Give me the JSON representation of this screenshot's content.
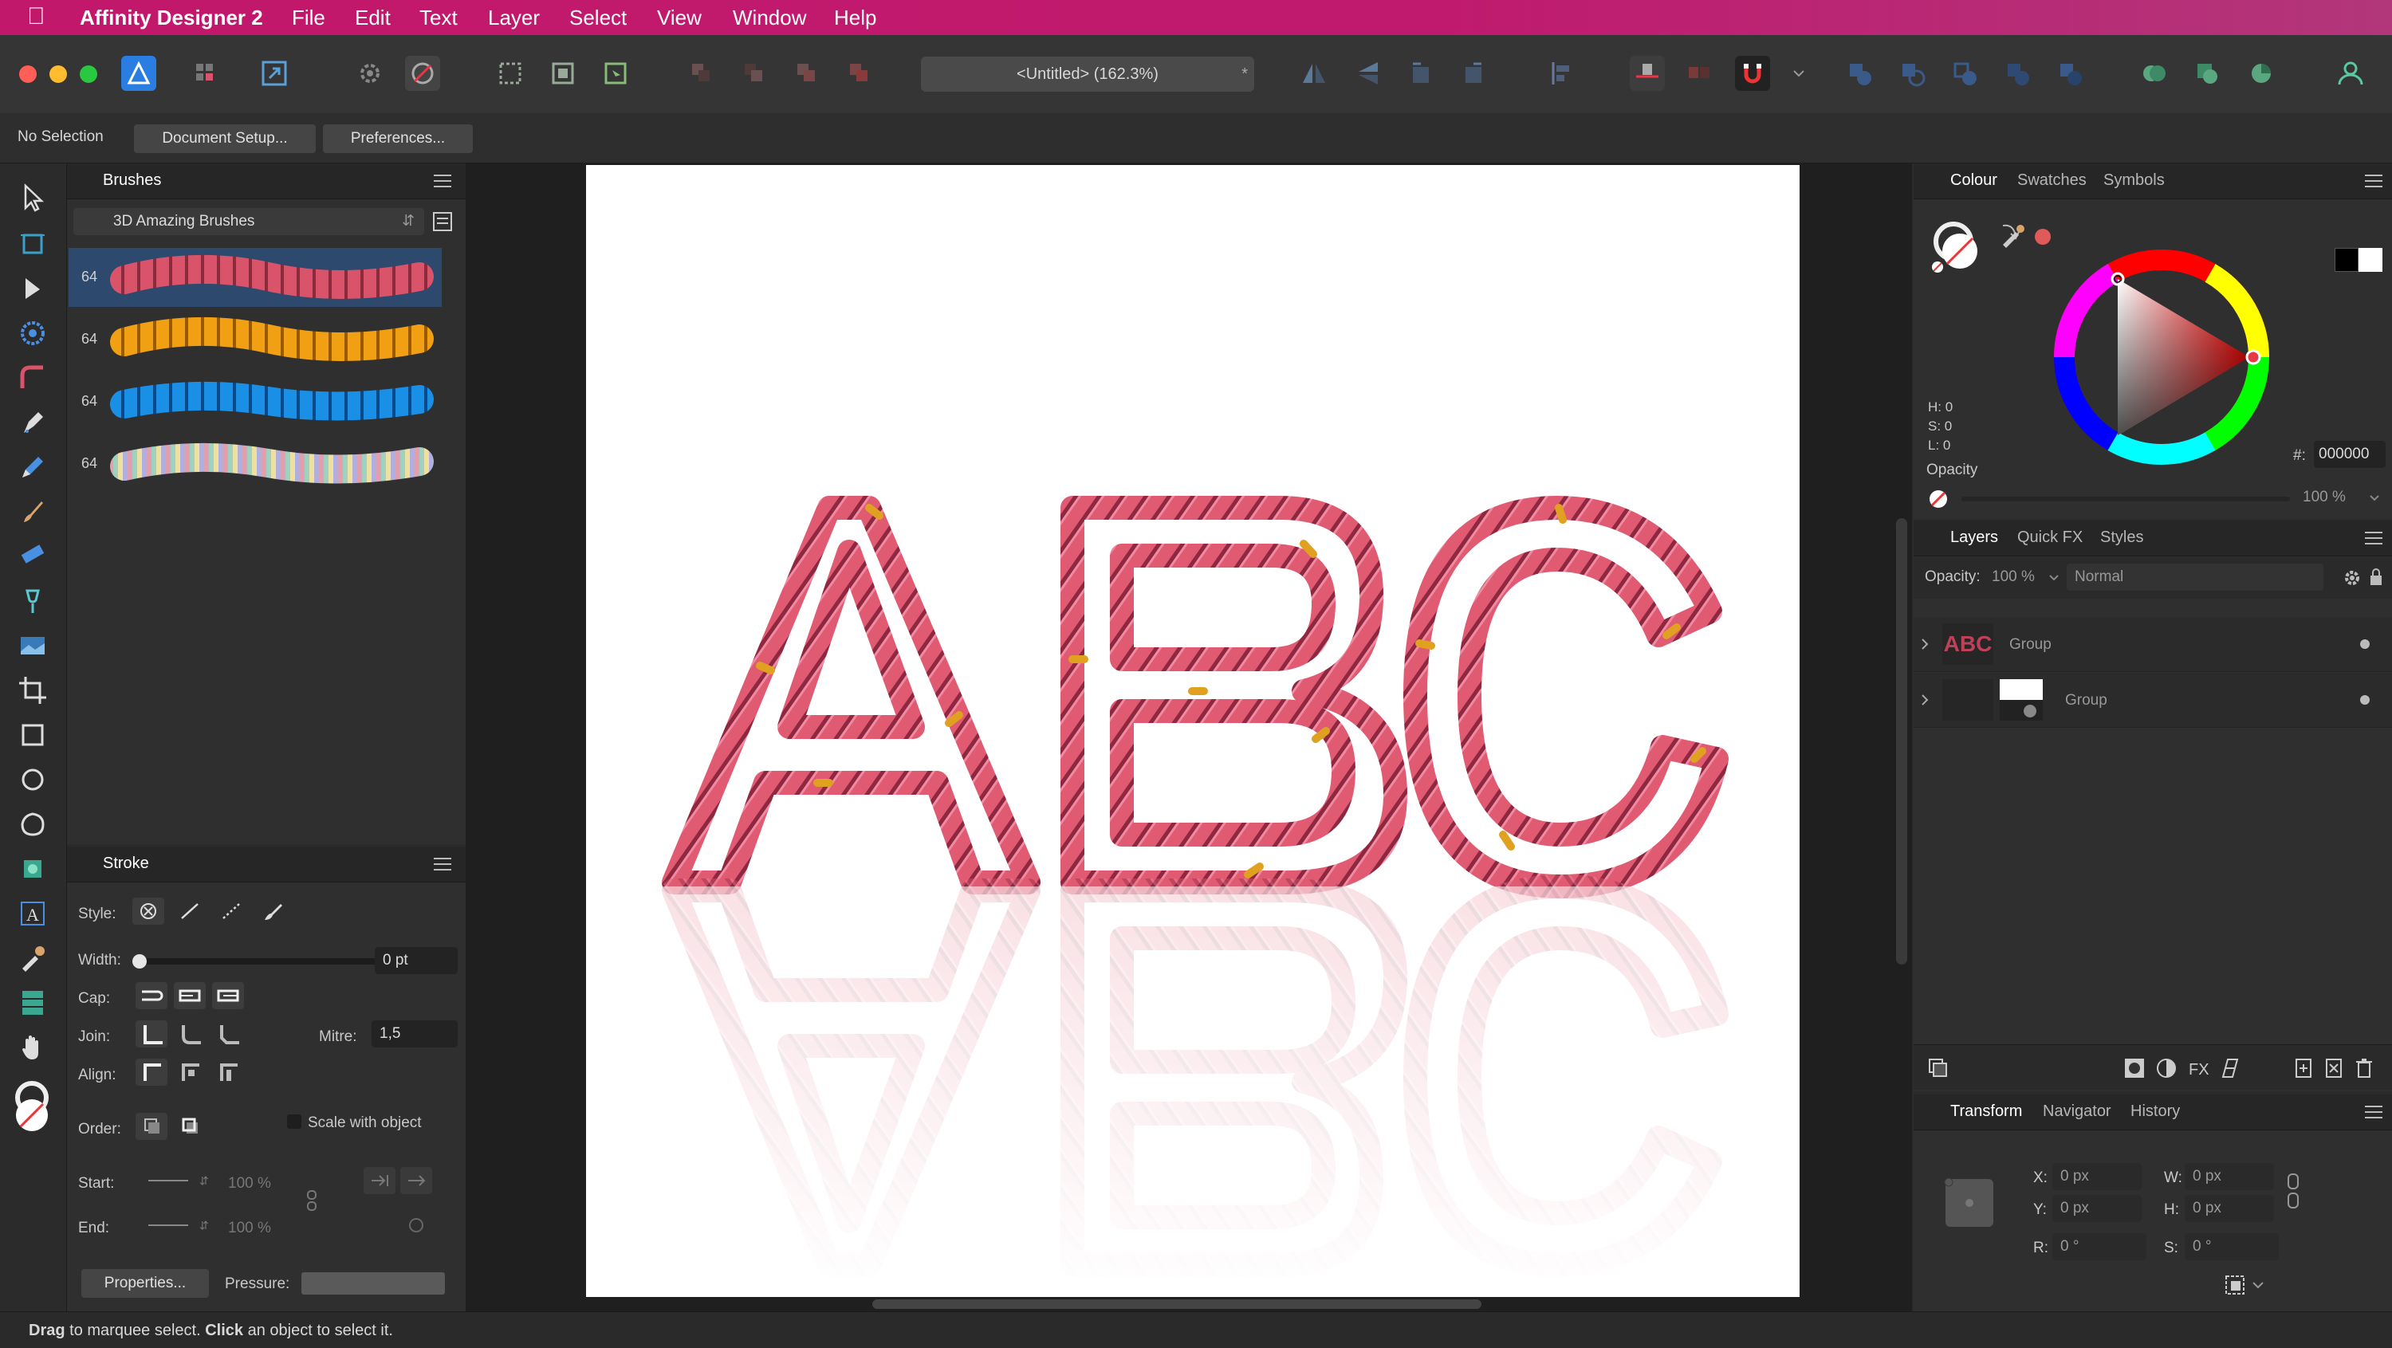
{
  "app": {
    "name": "Affinity Designer 2"
  },
  "menu": [
    "File",
    "Edit",
    "Text",
    "Layer",
    "Select",
    "View",
    "Window",
    "Help"
  ],
  "toolbar": {
    "document_title": "<Untitled> (162.3%)",
    "close_mark": "*"
  },
  "context": {
    "selection": "No Selection",
    "document_setup": "Document Setup...",
    "preferences": "Preferences..."
  },
  "brushes": {
    "title": "Brushes",
    "category": "3D Amazing Brushes",
    "items": [
      {
        "size": "64",
        "color": "#d9546a"
      },
      {
        "size": "64",
        "color": "#f0a012"
      },
      {
        "size": "64",
        "color": "#1a8fe6"
      },
      {
        "size": "64",
        "color": "#9ec4b0"
      }
    ]
  },
  "stroke": {
    "title": "Stroke",
    "style_label": "Style:",
    "width_label": "Width:",
    "width_value": "0 pt",
    "cap_label": "Cap:",
    "join_label": "Join:",
    "mitre_label": "Mitre:",
    "mitre_value": "1,5",
    "align_label": "Align:",
    "order_label": "Order:",
    "scale_with_object": "Scale with object",
    "start_label": "Start:",
    "start_pct": "100 %",
    "end_label": "End:",
    "end_pct": "100 %",
    "properties_button": "Properties...",
    "pressure_label": "Pressure:"
  },
  "colour": {
    "tabs": [
      "Colour",
      "Swatches",
      "Symbols"
    ],
    "h": "H: 0",
    "s": "S: 0",
    "l": "L: 0",
    "opacity_label": "Opacity",
    "opacity_value": "100 %",
    "hex_label": "#:",
    "hex_value": "000000",
    "accent": "#e63946"
  },
  "layers": {
    "tabs": [
      "Layers",
      "Quick FX",
      "Styles"
    ],
    "opacity_label": "Opacity:",
    "opacity_value": "100 %",
    "blend_mode": "Normal",
    "rows": [
      {
        "thumb_text": "ABC",
        "name": "Group"
      },
      {
        "thumb_text": "",
        "name": "Group"
      }
    ]
  },
  "transform": {
    "tabs": [
      "Transform",
      "Navigator",
      "History"
    ],
    "x_label": "X:",
    "x_value": "0 px",
    "y_label": "Y:",
    "y_value": "0 px",
    "w_label": "W:",
    "w_value": "0 px",
    "h_label": "H:",
    "h_value": "0 px",
    "r_label": "R:",
    "r_value": "0 °",
    "s_label": "S:",
    "s_value": "0 °"
  },
  "status": {
    "drag": "Drag",
    "drag_text": " to marquee select. ",
    "click": "Click",
    "click_text": " an object to select it."
  },
  "artwork": {
    "text": "ABC",
    "stroke_color": "#d94a62",
    "joint_color": "#e0a020"
  }
}
